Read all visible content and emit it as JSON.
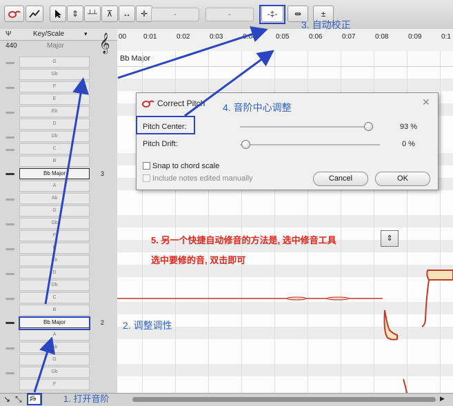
{
  "toolbar": {
    "field1": "-",
    "field2": "-"
  },
  "left": {
    "header_label": "Key/Scale",
    "tuning_ref": "440",
    "scale_mode": "Major",
    "notes_top": [
      "G",
      "Gb",
      "F",
      "E",
      "Eb",
      "D",
      "Db",
      "C",
      "B"
    ],
    "key_selected_1": "Bb Major",
    "key_count_1": "3",
    "notes_mid": [
      "A",
      "Ab",
      "G",
      "Gb",
      "F",
      "E",
      "Eb",
      "D",
      "Db",
      "C",
      "B"
    ],
    "key_selected_2": "Bb Major",
    "key_count_2": "2",
    "notes_bottom": [
      "A",
      "Ab",
      "G",
      "Gb",
      "F"
    ]
  },
  "ruler": {
    "ticks": [
      "00",
      "0:01",
      "0:02",
      "0:03",
      "0:04",
      "0:05",
      "0:06",
      "0:07",
      "0:08",
      "0:09",
      "0:1"
    ],
    "key_label": "Bb Major"
  },
  "dialog": {
    "title": "Correct Pitch",
    "pitch_center_label": "Pitch Center:",
    "pitch_center_value": "93 %",
    "pitch_center_level": 93,
    "pitch_drift_label": "Pitch Drift:",
    "pitch_drift_value": "0 %",
    "pitch_drift_level": 0,
    "snap_label": "Snap to chord scale",
    "include_label": "Include notes edited manually",
    "cancel": "Cancel",
    "ok": "OK"
  },
  "annotations": {
    "a1": "1. 打开音阶",
    "a2": "2. 调整调性",
    "a3": "3. 自动校正",
    "a4": "4. 音阶中心调整",
    "a5_line1": "5. 另一个快捷自动修音的方法是, 选中修音工具",
    "a5_line2": "选中要修的音, 双击即可"
  },
  "colors": {
    "annotation_blue": "#2f62c9",
    "annotation_red": "#e0261b",
    "box_blue": "#2a46c0"
  }
}
